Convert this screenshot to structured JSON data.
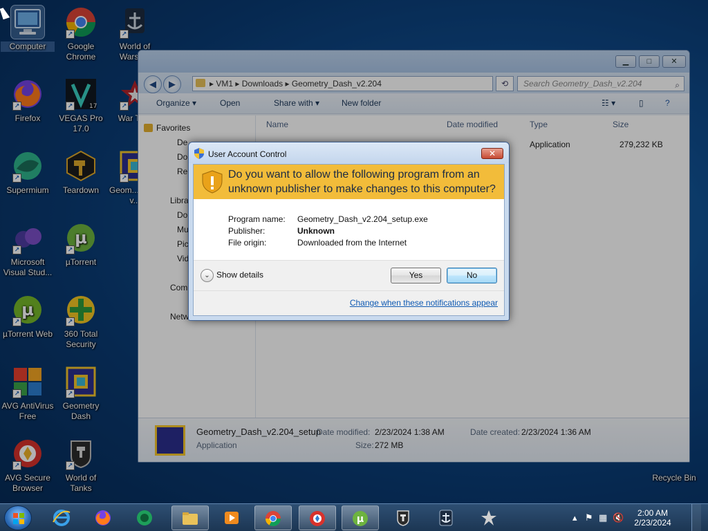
{
  "desktop": {
    "icons": [
      {
        "label": "Computer"
      },
      {
        "label": "Google Chrome"
      },
      {
        "label": "World of Warsh..."
      },
      {
        "label": "Firefox"
      },
      {
        "label": "VEGAS Pro 17.0"
      },
      {
        "label": "War Th..."
      },
      {
        "label": "Supermium"
      },
      {
        "label": "Teardown"
      },
      {
        "label": "Geom... Dash v..."
      },
      {
        "label": "Microsoft Visual Stud..."
      },
      {
        "label": "µTorrent"
      },
      {
        "label": "µTorrent Web"
      },
      {
        "label": "360 Total Security"
      },
      {
        "label": "AVG AntiVirus Free"
      },
      {
        "label": "Geometry Dash"
      },
      {
        "label": "AVG Secure Browser"
      },
      {
        "label": "World of Tanks"
      },
      {
        "label": "Recycle Bin"
      }
    ]
  },
  "explorer": {
    "breadcrumb": [
      "VM1",
      "Downloads",
      "Geometry_Dash_v2.204"
    ],
    "search_placeholder": "Search Geometry_Dash_v2.204",
    "toolbar": {
      "organize": "Organize",
      "open": "Open",
      "share_with": "Share with",
      "new_folder": "New folder"
    },
    "nav": {
      "favorites": "Favorites",
      "items": [
        "De...",
        "Do...",
        "Re...",
        "Libra...",
        "Do...",
        "Mu...",
        "Pic...",
        "Vid...",
        "Com...",
        "Netw..."
      ]
    },
    "columns": {
      "name": "Name",
      "date_modified": "Date modified",
      "type": "Type",
      "size": "Size"
    },
    "file_row": {
      "type": "Application",
      "size": "279,232 KB"
    },
    "details": {
      "filename": "Geometry_Dash_v2.204_setup",
      "filetype": "Application",
      "date_modified_label": "Date modified:",
      "date_modified": "2/23/2024 1:38 AM",
      "size_label": "Size:",
      "size": "272 MB",
      "date_created_label": "Date created:",
      "date_created": "2/23/2024 1:36 AM"
    }
  },
  "uac": {
    "title": "User Account Control",
    "question": "Do you want to allow the following program from an unknown publisher to make changes to this computer?",
    "program_name_label": "Program name:",
    "program_name": "Geometry_Dash_v2.204_setup.exe",
    "publisher_label": "Publisher:",
    "publisher": "Unknown",
    "file_origin_label": "File origin:",
    "file_origin": "Downloaded from the Internet",
    "show_details": "Show details",
    "yes": "Yes",
    "no": "No",
    "notifications_link": "Change when these notifications appear",
    "banner_color": "#f2bc3a"
  },
  "taskbar": {
    "time": "2:00 AM",
    "date": "2/23/2024"
  }
}
